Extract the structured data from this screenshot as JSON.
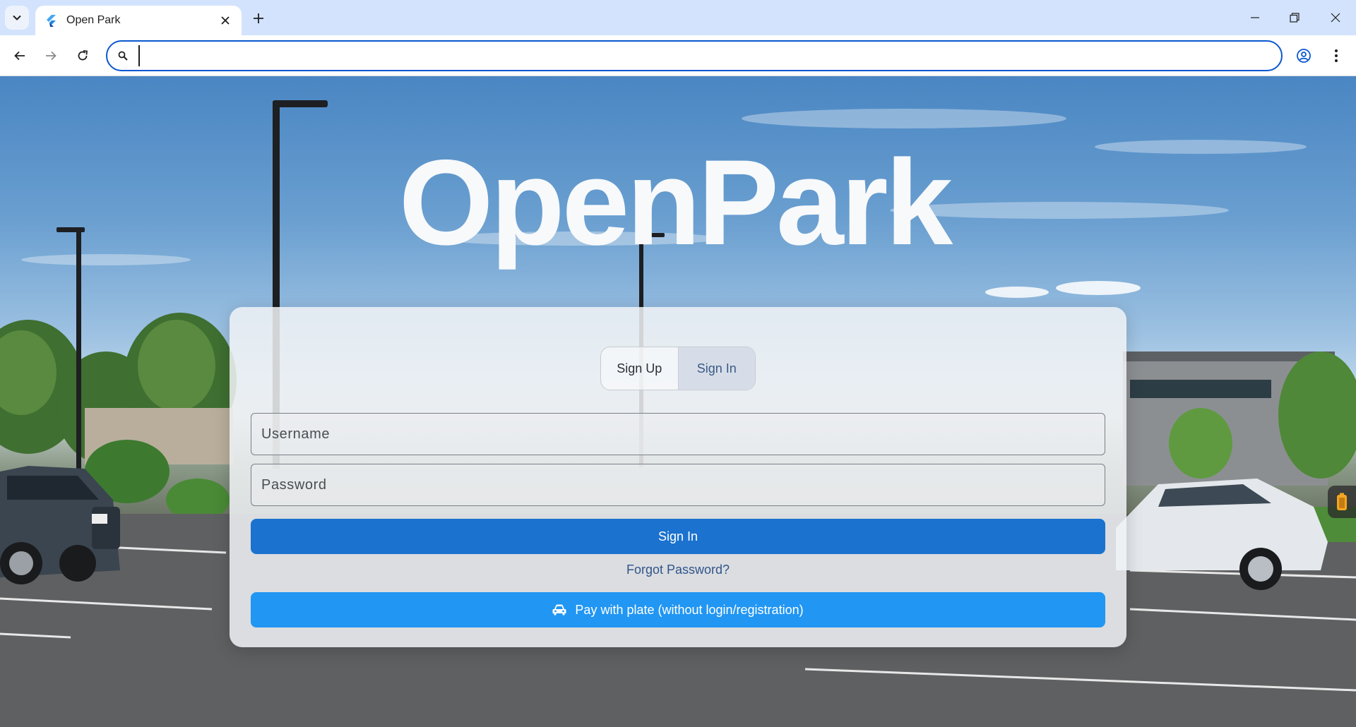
{
  "browser": {
    "tab_title": "Open Park",
    "address_value": "",
    "icons": {
      "tab_search": "chevron-down-icon",
      "favicon": "flutter-icon",
      "tab_close": "close-icon",
      "new_tab": "plus-icon",
      "back": "arrow-left-icon",
      "forward": "arrow-right-icon",
      "reload": "reload-icon",
      "omnibox": "search-icon",
      "profile": "account-circle-icon",
      "menu": "kebab-menu-icon",
      "minimize": "minimize-icon",
      "restore": "restore-icon",
      "close_window": "close-icon"
    },
    "accent": "#0b57d0"
  },
  "page": {
    "brand_title": "OpenPark",
    "auth_tabs": [
      {
        "label": "Sign Up",
        "active": false
      },
      {
        "label": "Sign In",
        "active": true
      }
    ],
    "username_placeholder": "Username",
    "password_placeholder": "Password",
    "sign_in_label": "Sign In",
    "forgot_label": "Forgot Password?",
    "plate_label": "Pay with plate (without login/registration)",
    "colors": {
      "primary": "#1b72cf",
      "secondary": "#2196f3",
      "link": "#30558a"
    }
  }
}
